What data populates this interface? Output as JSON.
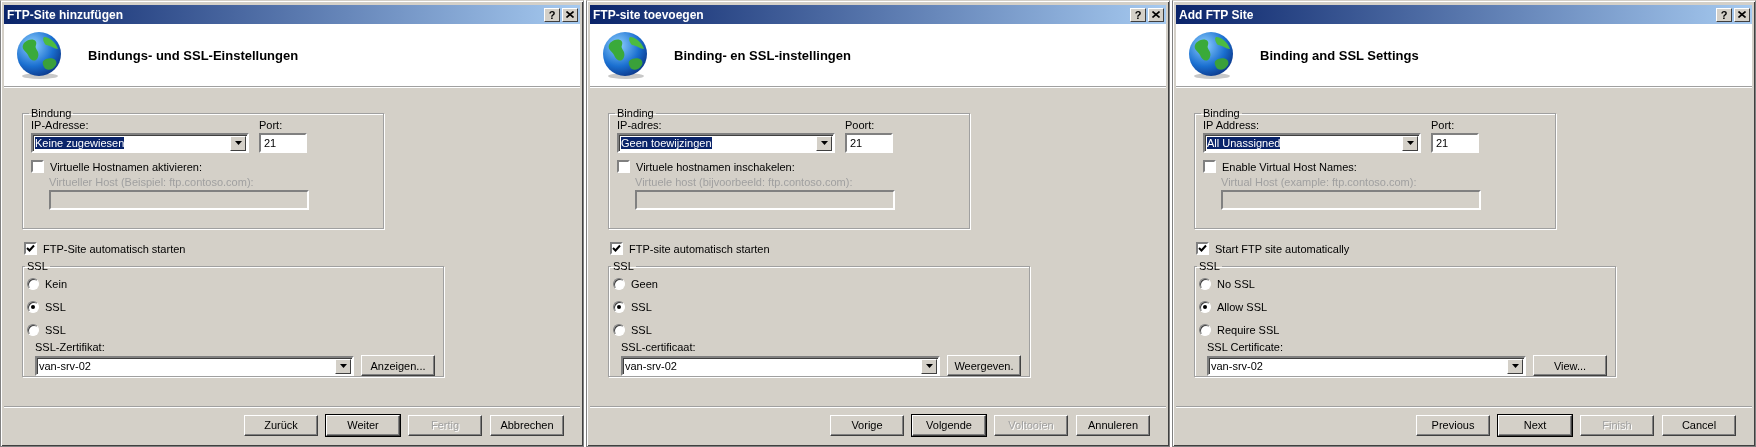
{
  "dialogs": [
    {
      "title": "FTP-Site hinzufügen",
      "help": "?",
      "heading": "Bindungs- und SSL-Einstellungen",
      "binding": {
        "legend": "Bindung",
        "ip_label": "IP-Adresse:",
        "ip_value": "Keine zugewiesen",
        "ip_focused": true,
        "port_label": "Port:",
        "port_value": "21",
        "virtual_names": {
          "label": "Virtuelle Hostnamen aktivieren:",
          "checked": false
        },
        "virtual_host": {
          "label": "Virtueller Host (Beispiel: ftp.contoso.com):",
          "disabled": true
        }
      },
      "auto_start": {
        "label": "FTP-Site automatisch starten",
        "checked": true
      },
      "ssl": {
        "legend": "SSL",
        "options": [
          {
            "label": "Kein",
            "selected": false
          },
          {
            "label": "SSL",
            "selected": true
          },
          {
            "label": "SSL",
            "selected": false
          }
        ],
        "certificate_label": "SSL-Zertifikat:",
        "certificate_value": "van-srv-02",
        "view_button": "Anzeigen..."
      },
      "buttons": [
        {
          "label": "Zurück",
          "default": false,
          "disabled": false
        },
        {
          "label": "Weiter",
          "default": true,
          "disabled": false
        },
        {
          "label": "Fertig",
          "default": false,
          "disabled": true
        },
        {
          "label": "Abbrechen",
          "default": false,
          "disabled": false
        }
      ]
    },
    {
      "title": "FTP-site toevoegen",
      "help": "?",
      "heading": "Binding- en SSL-instellingen",
      "binding": {
        "legend": "Binding",
        "ip_label": "IP-adres:",
        "ip_value": "Geen toewijzingen",
        "ip_focused": true,
        "port_label": "Poort:",
        "port_value": "21",
        "virtual_names": {
          "label": "Virtuele hostnamen inschakelen:",
          "checked": false
        },
        "virtual_host": {
          "label": "Virtuele host (bijvoorbeeld: ftp.contoso.com):",
          "disabled": true
        }
      },
      "auto_start": {
        "label": "FTP-site automatisch starten",
        "checked": true
      },
      "ssl": {
        "legend": "SSL",
        "options": [
          {
            "label": "Geen",
            "selected": false
          },
          {
            "label": "SSL",
            "selected": true
          },
          {
            "label": "SSL",
            "selected": false
          }
        ],
        "certificate_label": "SSL-certificaat:",
        "certificate_value": "van-srv-02",
        "view_button": "Weergeven."
      },
      "buttons": [
        {
          "label": "Vorige",
          "default": false,
          "disabled": false
        },
        {
          "label": "Volgende",
          "default": true,
          "disabled": false
        },
        {
          "label": "Voltooien",
          "default": false,
          "disabled": true
        },
        {
          "label": "Annuleren",
          "default": false,
          "disabled": false
        }
      ]
    },
    {
      "title": "Add FTP Site",
      "help": "?",
      "heading": "Binding and SSL Settings",
      "binding": {
        "legend": "Binding",
        "ip_label": "IP Address:",
        "ip_value": "All Unassigned",
        "ip_focused": true,
        "port_label": "Port:",
        "port_value": "21",
        "virtual_names": {
          "label": "Enable Virtual Host Names:",
          "checked": false
        },
        "virtual_host": {
          "label": "Virtual Host (example: ftp.contoso.com):",
          "disabled": true
        }
      },
      "auto_start": {
        "label": "Start FTP site automatically",
        "checked": true
      },
      "ssl": {
        "legend": "SSL",
        "options": [
          {
            "label": "No SSL",
            "selected": false
          },
          {
            "label": "Allow SSL",
            "selected": true
          },
          {
            "label": "Require SSL",
            "selected": false
          }
        ],
        "certificate_label": "SSL Certificate:",
        "certificate_value": "van-srv-02",
        "view_button": "View..."
      },
      "buttons": [
        {
          "label": "Previous",
          "default": false,
          "disabled": false
        },
        {
          "label": "Next",
          "default": true,
          "disabled": false
        },
        {
          "label": "Finish",
          "default": false,
          "disabled": true
        },
        {
          "label": "Cancel",
          "default": false,
          "disabled": false
        }
      ]
    }
  ]
}
